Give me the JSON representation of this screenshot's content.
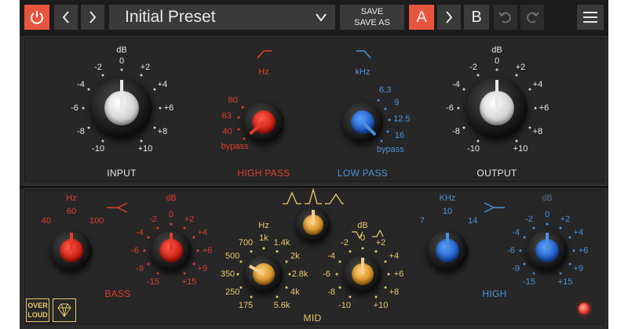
{
  "toolbar": {
    "preset_name": "Initial Preset",
    "save_label": "SAVE",
    "save_as_label": "SAVE AS",
    "slot_a": "A",
    "slot_b": "B"
  },
  "input": {
    "label": "INPUT",
    "unit": "dB",
    "scale": [
      "-10",
      "-8",
      "-6",
      "-4",
      "-2",
      "0",
      "+2",
      "+4",
      "+6",
      "+8",
      "+10"
    ],
    "value_db": 0
  },
  "output": {
    "label": "OUTPUT",
    "unit": "dB",
    "scale": [
      "-10",
      "-8",
      "-6",
      "-4",
      "-2",
      "0",
      "+2",
      "+4",
      "+6",
      "+8",
      "+10"
    ],
    "value_db": 0
  },
  "high_pass": {
    "label": "HIGH PASS",
    "unit": "Hz",
    "scale": [
      "bypass",
      "40",
      "63",
      "80"
    ],
    "value": "bypass"
  },
  "low_pass": {
    "label": "LOW PASS",
    "unit": "kHz",
    "scale": [
      "6.3",
      "9",
      "12.5",
      "16",
      "bypass"
    ],
    "value": "bypass"
  },
  "bass": {
    "label": "BASS",
    "freq_unit": "Hz",
    "freq_scale": [
      "40",
      "60",
      "100"
    ],
    "freq_value": "60",
    "gain_unit": "dB",
    "gain_scale": [
      "-15",
      "-9",
      "-6",
      "-4",
      "-2",
      "0",
      "+2",
      "+4",
      "+6",
      "+9",
      "+15"
    ],
    "gain_value": "0"
  },
  "mid": {
    "label": "MID",
    "freq_unit": "Hz",
    "freq_scale": [
      "175",
      "250",
      "350",
      "500",
      "700",
      "1k",
      "1.4k",
      "2k",
      "2.8k",
      "4k",
      "5.6k"
    ],
    "gain_unit": "dB",
    "gain_scale": [
      "-10",
      "-8",
      "-6",
      "-4",
      "-2",
      "0",
      "+2",
      "+4",
      "+6",
      "+8",
      "+10"
    ],
    "gain_value": "0"
  },
  "high": {
    "label": "HIGH",
    "freq_unit": "KHz",
    "freq_scale": [
      "7",
      "10",
      "14"
    ],
    "freq_value": "10",
    "gain_unit": "dB",
    "gain_scale": [
      "-15",
      "-9",
      "-6",
      "-4",
      "-2",
      "0",
      "+2",
      "+4",
      "+6",
      "+9",
      "+15"
    ],
    "gain_value": "0"
  },
  "brand": {
    "logo_line1": "OVER",
    "logo_line2": "LOUD"
  },
  "colors": {
    "power": "#e8553e",
    "active_slot": "#e8553e",
    "red": "#e03b2e",
    "blue": "#4a8fd8",
    "gold": "#e8c86a"
  }
}
